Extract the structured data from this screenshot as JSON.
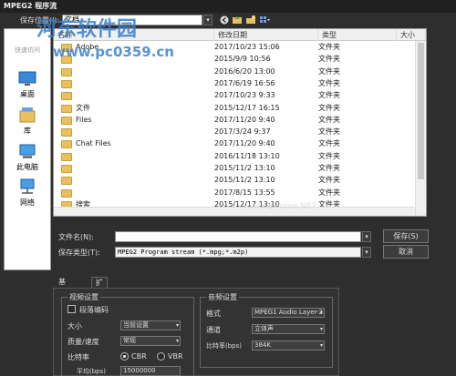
{
  "window": {
    "title": "MPEG2 程序流"
  },
  "toolbar": {
    "save_in_label": "保存位置(I):",
    "location": "文档",
    "dd_caret": "▾"
  },
  "places": [
    {
      "name": "快速访问",
      "label": "快速访问"
    },
    {
      "name": "desktop",
      "label": "桌面"
    },
    {
      "name": "library",
      "label": "库"
    },
    {
      "name": "this-pc",
      "label": "此电脑"
    },
    {
      "name": "network",
      "label": "网络"
    }
  ],
  "list": {
    "headers": {
      "name": "名称",
      "date": "修改日期",
      "type": "类型",
      "size": "大小"
    },
    "rows": [
      {
        "name": "Adobe",
        "date": "2017/10/23 15:06",
        "type": "文件夹"
      },
      {
        "name": "",
        "date": "2015/9/9 10:56",
        "type": "文件夹"
      },
      {
        "name": "",
        "date": "2016/6/20 13:00",
        "type": "文件夹"
      },
      {
        "name": "",
        "date": "2017/6/19 16:56",
        "type": "文件夹"
      },
      {
        "name": "",
        "date": "2017/10/23 9:33",
        "type": "文件夹"
      },
      {
        "name": "文件",
        "date": "2015/12/17 16:15",
        "type": "文件夹"
      },
      {
        "name": "Files",
        "date": "2017/11/20 9:40",
        "type": "文件夹"
      },
      {
        "name": "",
        "date": "2017/3/24 9:37",
        "type": "文件夹"
      },
      {
        "name": "Chat Files",
        "date": "2017/11/20 9:40",
        "type": "文件夹"
      },
      {
        "name": "",
        "date": "2016/11/18 13:10",
        "type": "文件夹"
      },
      {
        "name": "",
        "date": "2015/11/2 13:10",
        "type": "文件夹"
      },
      {
        "name": "",
        "date": "2015/11/2 13:10",
        "type": "文件夹"
      },
      {
        "name": "",
        "date": "2017/8/15 13:55",
        "type": "文件夹"
      },
      {
        "name": "搜索",
        "date": "2015/12/17 13:10",
        "type": "文件夹"
      }
    ]
  },
  "filename": {
    "label": "文件名(N):",
    "value": ""
  },
  "filetype": {
    "label": "保存类型(T):",
    "value": "MPEG2 Program stream (*.mpg;*.m2p)"
  },
  "buttons": {
    "save": "保存(S)",
    "cancel": "取消"
  },
  "tabs": {
    "basic": "基本设置",
    "ext": "扩展设置"
  },
  "video": {
    "title": "视频设置",
    "segment": "段落编码",
    "size_label": "大小",
    "size_value": "当前设置",
    "quality_label": "质量/速度",
    "quality_value": "常规",
    "bitrate_label": "比特率",
    "cbr": "CBR",
    "vbr": "VBR",
    "avg_label": "平均(bps)",
    "avg_value": "15000000"
  },
  "audio": {
    "title": "音频设置",
    "format_label": "格式",
    "format_value": "MPEG1 Audio Layer-2",
    "channel_label": "通道",
    "channel_value": "立体声",
    "bitrate_label": "比特率(bps)",
    "bitrate_value": "384K"
  },
  "watermark": {
    "main": "河东软件园",
    "url": "www.pc0359.cn",
    "faint": "www.pHome.NET"
  }
}
